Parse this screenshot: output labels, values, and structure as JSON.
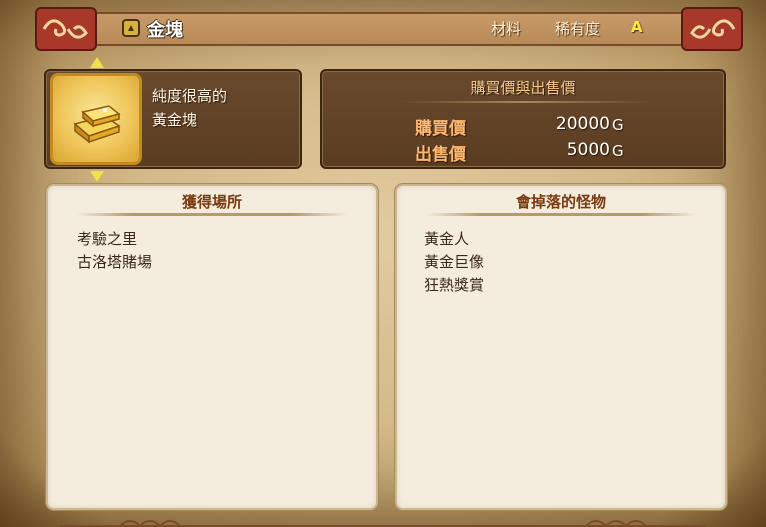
{
  "header": {
    "title": "金塊",
    "category": "材料",
    "rarity_label": "稀有度",
    "rarity_value": "A",
    "icon": "material-icon"
  },
  "item": {
    "icon": "gold-bar-icon",
    "description_line1": "純度很高的",
    "description_line2": "黃金塊"
  },
  "prices": {
    "title": "購買價與出售價",
    "buy_label": "購買價",
    "buy_value": "20000",
    "sell_label": "出售價",
    "sell_value": "5000",
    "unit": "G"
  },
  "obtain": {
    "title": "獲得場所",
    "items": [
      "考驗之里",
      "古洛塔賭場"
    ]
  },
  "drops": {
    "title": "會掉落的怪物",
    "items": [
      "黃金人",
      "黃金巨像",
      "狂熱獎賞"
    ]
  },
  "colors": {
    "header_band": "#b88a58",
    "dark_panel": "#5a3c22",
    "light_panel": "#f4ecdd",
    "price_label": "#ffb870",
    "rarity_grade": "#ffe93a",
    "nav_arrow": "#f0e04a"
  }
}
